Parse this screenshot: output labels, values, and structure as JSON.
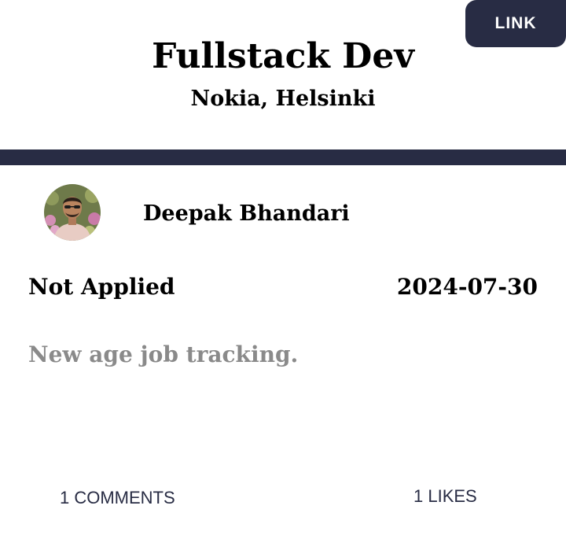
{
  "header": {
    "link_label": "LINK",
    "job_title": "Fullstack Dev",
    "location": "Nokia, Helsinki"
  },
  "author": {
    "name": "Deepak Bhandari",
    "avatar_icon": "user-avatar-photo"
  },
  "details": {
    "status": "Not Applied",
    "date": "2024-07-30",
    "description": "New age job tracking."
  },
  "footer": {
    "comments": "1 COMMENTS",
    "likes": "1 LIKES"
  },
  "colors": {
    "accent": "#282c44",
    "muted_text": "#8a8a8a",
    "background": "#ffffff"
  }
}
